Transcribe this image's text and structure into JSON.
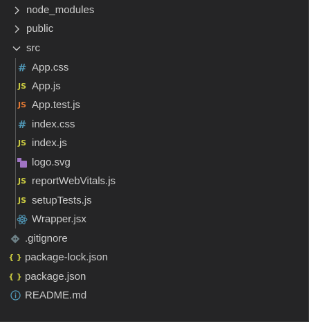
{
  "colors": {
    "background": "#252526",
    "text": "#cccccc",
    "js": "#cbcb41",
    "test_js": "#e37933",
    "css": "#519aba",
    "svg": "#a074c4",
    "react": "#519aba",
    "json": "#cbcb41",
    "git": "#6d8086",
    "info": "#519aba"
  },
  "tree": {
    "folders": {
      "node_modules": {
        "label": "node_modules",
        "icon": "chevron-right-icon",
        "expanded": false
      },
      "public": {
        "label": "public",
        "icon": "chevron-right-icon",
        "expanded": false
      },
      "src": {
        "label": "src",
        "icon": "chevron-down-icon",
        "expanded": true
      }
    },
    "src_files": [
      {
        "label": "App.css",
        "icon": "css-file-icon",
        "glyph": "#"
      },
      {
        "label": "App.js",
        "icon": "js-file-icon",
        "glyph": "JS"
      },
      {
        "label": "App.test.js",
        "icon": "js-test-file-icon",
        "glyph": "JS"
      },
      {
        "label": "index.css",
        "icon": "css-file-icon",
        "glyph": "#"
      },
      {
        "label": "index.js",
        "icon": "js-file-icon",
        "glyph": "JS"
      },
      {
        "label": "logo.svg",
        "icon": "svg-file-icon",
        "glyph": ""
      },
      {
        "label": "reportWebVitals.js",
        "icon": "js-file-icon",
        "glyph": "JS"
      },
      {
        "label": "setupTests.js",
        "icon": "js-file-icon",
        "glyph": "JS"
      },
      {
        "label": "Wrapper.jsx",
        "icon": "react-file-icon",
        "glyph": ""
      }
    ],
    "root_files": [
      {
        "label": ".gitignore",
        "icon": "git-file-icon",
        "glyph": ""
      },
      {
        "label": "package-lock.json",
        "icon": "json-file-icon",
        "glyph": "{ }"
      },
      {
        "label": "package.json",
        "icon": "json-file-icon",
        "glyph": "{ }"
      },
      {
        "label": "README.md",
        "icon": "info-file-icon",
        "glyph": ""
      }
    ]
  }
}
